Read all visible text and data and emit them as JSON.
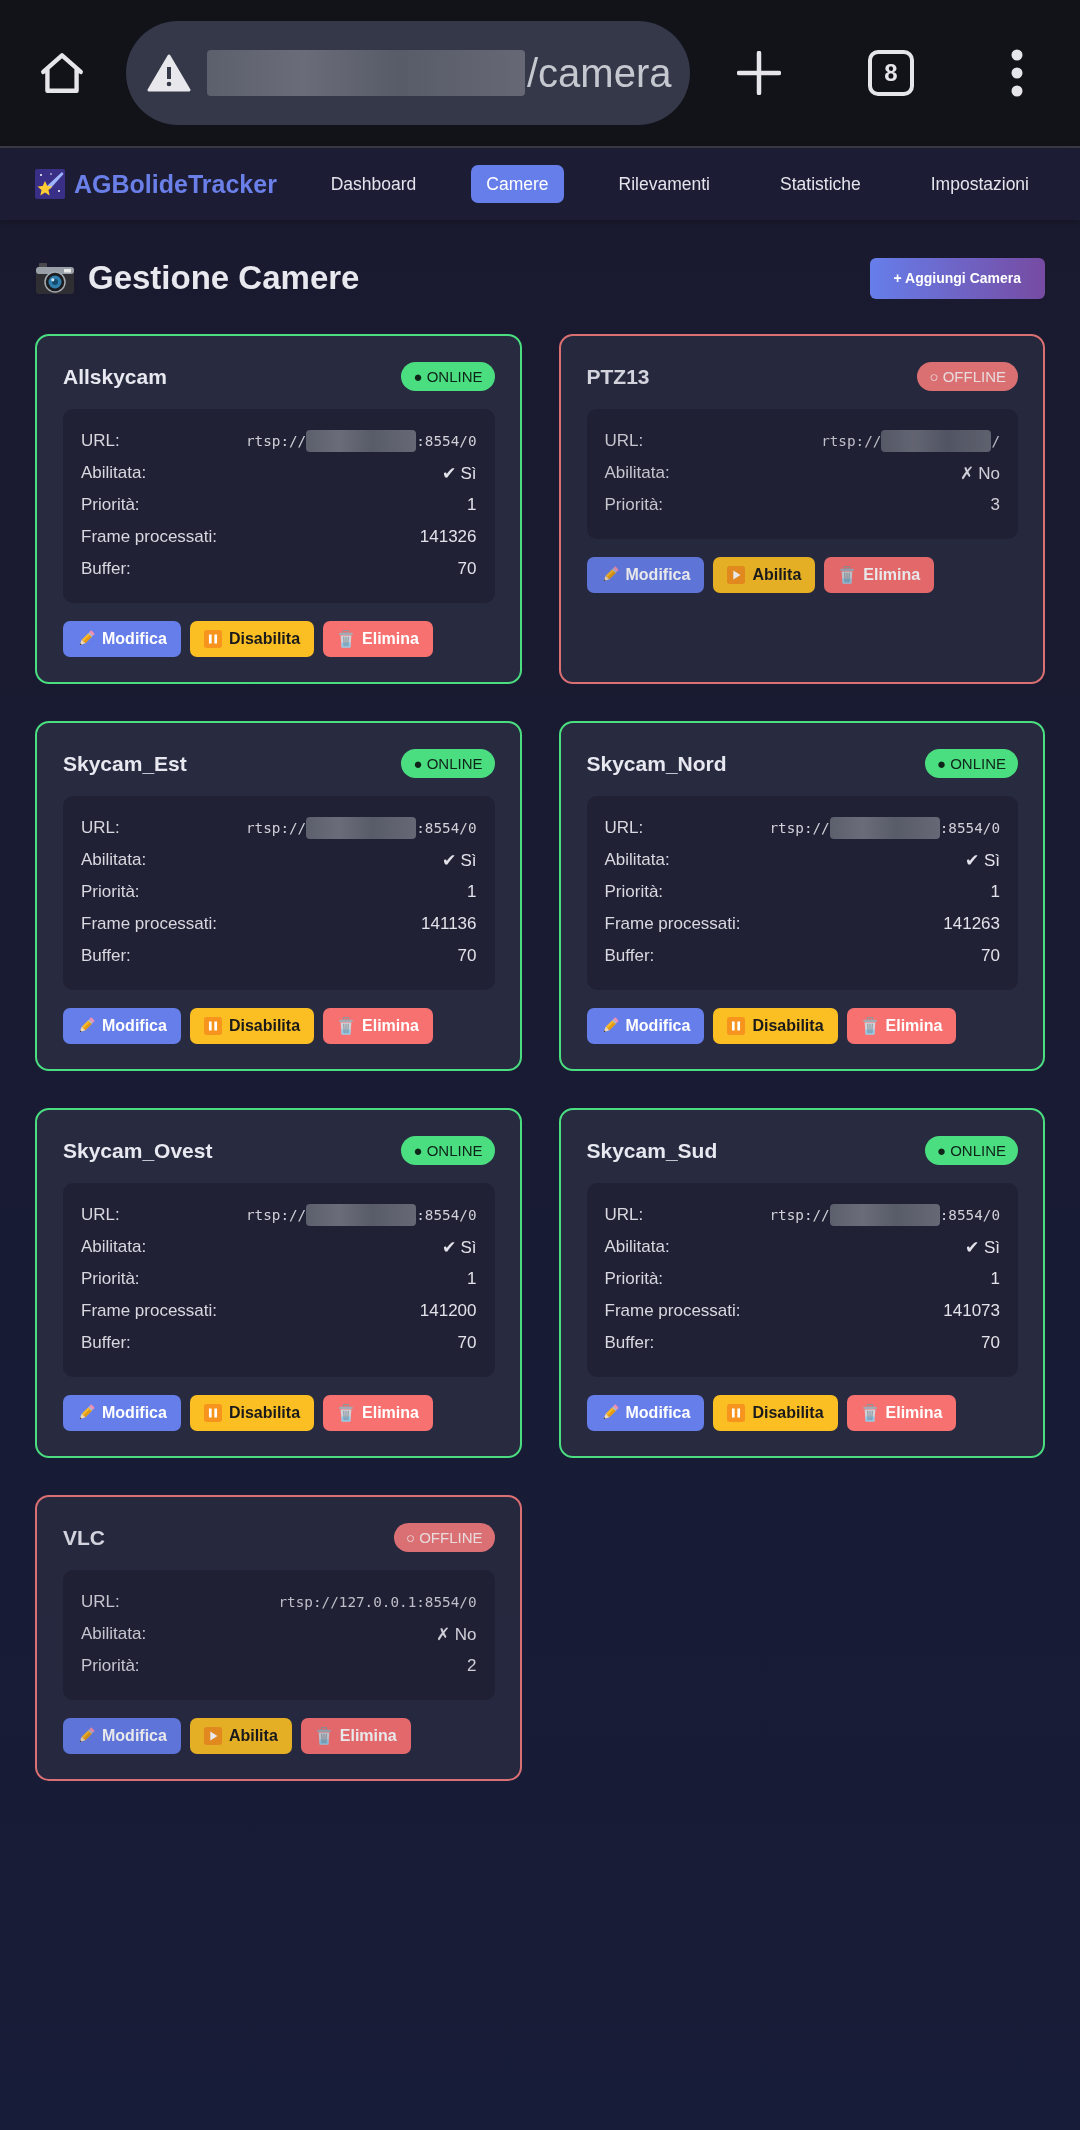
{
  "browser": {
    "address_parts": [
      {
        "kind": "redacted"
      },
      {
        "kind": "text",
        "text": "/camera"
      }
    ],
    "tab_count": "8"
  },
  "nav": {
    "logo": "AGBolideTracker",
    "items": [
      {
        "label": "Dashboard",
        "selected": false
      },
      {
        "label": "Camere",
        "selected": true
      },
      {
        "label": "Rilevamenti",
        "selected": false
      },
      {
        "label": "Statistiche",
        "selected": false
      },
      {
        "label": "Impostazioni",
        "selected": false
      }
    ]
  },
  "page": {
    "title": "Gestione Camere",
    "add_button": "+ Aggiungi Camera"
  },
  "cameras": [
    {
      "name": "Allskycam",
      "online": true,
      "badge": "● ONLINE",
      "fields": [
        {
          "kind": "url",
          "label": "URL:",
          "parts": [
            {
              "kind": "text",
              "text": "rtsp://"
            },
            {
              "kind": "redacted"
            },
            {
              "kind": "text",
              "text": ":8554/0"
            }
          ]
        },
        {
          "kind": "text",
          "label": "Abilitata:",
          "value": "✔ Sì"
        },
        {
          "kind": "text",
          "label": "Priorità:",
          "value": "1"
        },
        {
          "kind": "text",
          "label": "Frame processati:",
          "value": "141326"
        },
        {
          "kind": "text",
          "label": "Buffer:",
          "value": "70"
        }
      ],
      "buttons": [
        {
          "kind": "edit",
          "label": "Modifica"
        },
        {
          "kind": "disable",
          "label": "Disabilita"
        },
        {
          "kind": "delete",
          "label": "Elimina"
        }
      ]
    },
    {
      "name": "PTZ13",
      "online": false,
      "badge": "○ OFFLINE",
      "fields": [
        {
          "kind": "url",
          "label": "URL:",
          "parts": [
            {
              "kind": "text",
              "text": "rtsp://"
            },
            {
              "kind": "redacted"
            },
            {
              "kind": "text",
              "text": "/"
            }
          ]
        },
        {
          "kind": "text",
          "label": "Abilitata:",
          "value": "✗ No"
        },
        {
          "kind": "text",
          "label": "Priorità:",
          "value": "3"
        }
      ],
      "buttons": [
        {
          "kind": "edit",
          "label": "Modifica"
        },
        {
          "kind": "enable",
          "label": "Abilita"
        },
        {
          "kind": "delete",
          "label": "Elimina"
        }
      ]
    },
    {
      "name": "Skycam_Est",
      "online": true,
      "badge": "● ONLINE",
      "fields": [
        {
          "kind": "url",
          "label": "URL:",
          "parts": [
            {
              "kind": "text",
              "text": "rtsp://"
            },
            {
              "kind": "redacted"
            },
            {
              "kind": "text",
              "text": ":8554/0"
            }
          ]
        },
        {
          "kind": "text",
          "label": "Abilitata:",
          "value": "✔ Sì"
        },
        {
          "kind": "text",
          "label": "Priorità:",
          "value": "1"
        },
        {
          "kind": "text",
          "label": "Frame processati:",
          "value": "141136"
        },
        {
          "kind": "text",
          "label": "Buffer:",
          "value": "70"
        }
      ],
      "buttons": [
        {
          "kind": "edit",
          "label": "Modifica"
        },
        {
          "kind": "disable",
          "label": "Disabilita"
        },
        {
          "kind": "delete",
          "label": "Elimina"
        }
      ]
    },
    {
      "name": "Skycam_Nord",
      "online": true,
      "badge": "● ONLINE",
      "fields": [
        {
          "kind": "url",
          "label": "URL:",
          "parts": [
            {
              "kind": "text",
              "text": "rtsp://"
            },
            {
              "kind": "redacted"
            },
            {
              "kind": "text",
              "text": ":8554/0"
            }
          ]
        },
        {
          "kind": "text",
          "label": "Abilitata:",
          "value": "✔ Sì"
        },
        {
          "kind": "text",
          "label": "Priorità:",
          "value": "1"
        },
        {
          "kind": "text",
          "label": "Frame processati:",
          "value": "141263"
        },
        {
          "kind": "text",
          "label": "Buffer:",
          "value": "70"
        }
      ],
      "buttons": [
        {
          "kind": "edit",
          "label": "Modifica"
        },
        {
          "kind": "disable",
          "label": "Disabilita"
        },
        {
          "kind": "delete",
          "label": "Elimina"
        }
      ]
    },
    {
      "name": "Skycam_Ovest",
      "online": true,
      "badge": "● ONLINE",
      "fields": [
        {
          "kind": "url",
          "label": "URL:",
          "parts": [
            {
              "kind": "text",
              "text": "rtsp://"
            },
            {
              "kind": "redacted"
            },
            {
              "kind": "text",
              "text": ":8554/0"
            }
          ]
        },
        {
          "kind": "text",
          "label": "Abilitata:",
          "value": "✔ Sì"
        },
        {
          "kind": "text",
          "label": "Priorità:",
          "value": "1"
        },
        {
          "kind": "text",
          "label": "Frame processati:",
          "value": "141200"
        },
        {
          "kind": "text",
          "label": "Buffer:",
          "value": "70"
        }
      ],
      "buttons": [
        {
          "kind": "edit",
          "label": "Modifica"
        },
        {
          "kind": "disable",
          "label": "Disabilita"
        },
        {
          "kind": "delete",
          "label": "Elimina"
        }
      ]
    },
    {
      "name": "Skycam_Sud",
      "online": true,
      "badge": "● ONLINE",
      "fields": [
        {
          "kind": "url",
          "label": "URL:",
          "parts": [
            {
              "kind": "text",
              "text": "rtsp://"
            },
            {
              "kind": "redacted"
            },
            {
              "kind": "text",
              "text": ":8554/0"
            }
          ]
        },
        {
          "kind": "text",
          "label": "Abilitata:",
          "value": "✔ Sì"
        },
        {
          "kind": "text",
          "label": "Priorità:",
          "value": "1"
        },
        {
          "kind": "text",
          "label": "Frame processati:",
          "value": "141073"
        },
        {
          "kind": "text",
          "label": "Buffer:",
          "value": "70"
        }
      ],
      "buttons": [
        {
          "kind": "edit",
          "label": "Modifica"
        },
        {
          "kind": "disable",
          "label": "Disabilita"
        },
        {
          "kind": "delete",
          "label": "Elimina"
        }
      ]
    },
    {
      "name": "VLC",
      "online": false,
      "badge": "○ OFFLINE",
      "fields": [
        {
          "kind": "url",
          "label": "URL:",
          "parts": [
            {
              "kind": "text",
              "text": "rtsp://127.0.0.1:8554/0"
            }
          ]
        },
        {
          "kind": "text",
          "label": "Abilitata:",
          "value": "✗ No"
        },
        {
          "kind": "text",
          "label": "Priorità:",
          "value": "2"
        }
      ],
      "buttons": [
        {
          "kind": "edit",
          "label": "Modifica"
        },
        {
          "kind": "enable",
          "label": "Abilita"
        },
        {
          "kind": "delete",
          "label": "Elimina"
        }
      ]
    }
  ]
}
